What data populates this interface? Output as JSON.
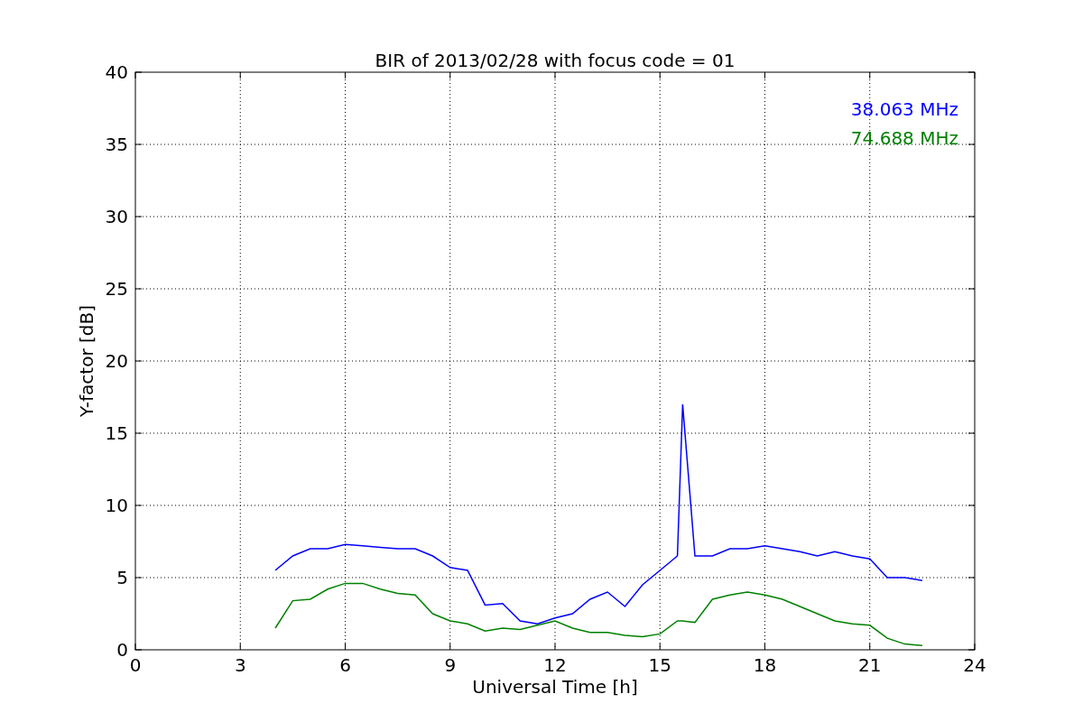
{
  "chart_data": {
    "type": "line",
    "title": "BIR of 2013/02/28 with focus code = 01",
    "xlabel": "Universal Time [h]",
    "ylabel": "Y-factor [dB]",
    "x": [
      4,
      4.5,
      5,
      5.5,
      6,
      6.5,
      7,
      7.5,
      8,
      8.5,
      9,
      9.5,
      10,
      10.5,
      11,
      11.5,
      12,
      12.5,
      13,
      13.5,
      14,
      14.5,
      15,
      15.5,
      15.65,
      16,
      16.5,
      17,
      17.5,
      18,
      18.5,
      19,
      19.5,
      20,
      20.5,
      21,
      21.5,
      22,
      22.5
    ],
    "series": [
      {
        "name": "38.063 MHz",
        "color": "#0000ff",
        "values": [
          5.5,
          6.5,
          7,
          7,
          7.3,
          7.2,
          7.1,
          7,
          7,
          6.5,
          5.7,
          5.5,
          3.1,
          3.2,
          2,
          1.8,
          2.2,
          2.5,
          3.5,
          4,
          3,
          4.5,
          5.5,
          6.5,
          17,
          6.5,
          6.5,
          7,
          7,
          7.2,
          7,
          6.8,
          6.5,
          6.8,
          6.5,
          6.3,
          5,
          5,
          4.8
        ]
      },
      {
        "name": "74.688 MHz",
        "color": "#008000",
        "values": [
          1.5,
          3.4,
          3.5,
          4.2,
          4.6,
          4.6,
          4.2,
          3.9,
          3.8,
          2.5,
          2,
          1.8,
          1.3,
          1.5,
          1.4,
          1.7,
          2,
          1.5,
          1.2,
          1.2,
          1,
          0.9,
          1.1,
          2,
          2,
          1.9,
          3.5,
          3.8,
          4,
          3.8,
          3.5,
          3,
          2.5,
          2,
          1.8,
          1.7,
          0.8,
          0.4,
          0.3
        ]
      }
    ],
    "grid": true,
    "xlim": [
      0,
      24
    ],
    "ylim": [
      0,
      40
    ],
    "xticks": [
      0,
      3,
      6,
      9,
      12,
      15,
      18,
      21,
      24
    ],
    "yticks": [
      0,
      5,
      10,
      15,
      20,
      25,
      30,
      35,
      40
    ]
  }
}
